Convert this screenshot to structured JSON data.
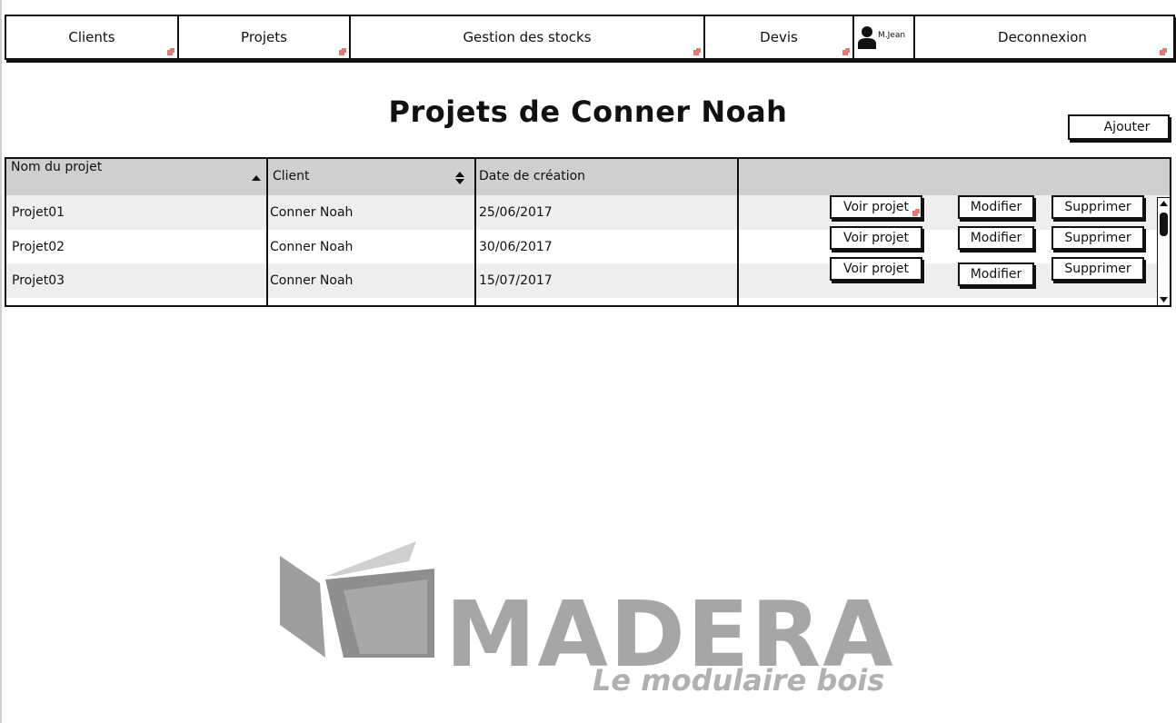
{
  "nav": {
    "items": [
      {
        "label": "Clients"
      },
      {
        "label": "Projets"
      },
      {
        "label": "Gestion des stocks"
      },
      {
        "label": "Devis"
      },
      {
        "label": "M.Jean"
      },
      {
        "label": "Deconnexion"
      }
    ]
  },
  "page": {
    "title": "Projets de Conner Noah",
    "add_label": "Ajouter"
  },
  "table": {
    "headers": [
      "Nom du projet",
      "Client",
      "Date de création"
    ],
    "rows": [
      {
        "name": "Projet01",
        "client": "Conner Noah",
        "date": "25/06/2017"
      },
      {
        "name": "Projet02",
        "client": "Conner Noah",
        "date": "30/06/2017"
      },
      {
        "name": "Projet03",
        "client": "Conner Noah",
        "date": "15/07/2017"
      }
    ],
    "actions": {
      "view": "Voir projet",
      "edit": "Modifier",
      "delete": "Supprimer"
    }
  },
  "logo": {
    "word": "MADERA",
    "tagline": "Le modulaire bois"
  },
  "colors": {
    "header_bg": "#cfcfcf",
    "row_alt_bg": "#eeeeee",
    "link_marker": "#e07a6e",
    "logo_gray": "#a6a6a6"
  }
}
